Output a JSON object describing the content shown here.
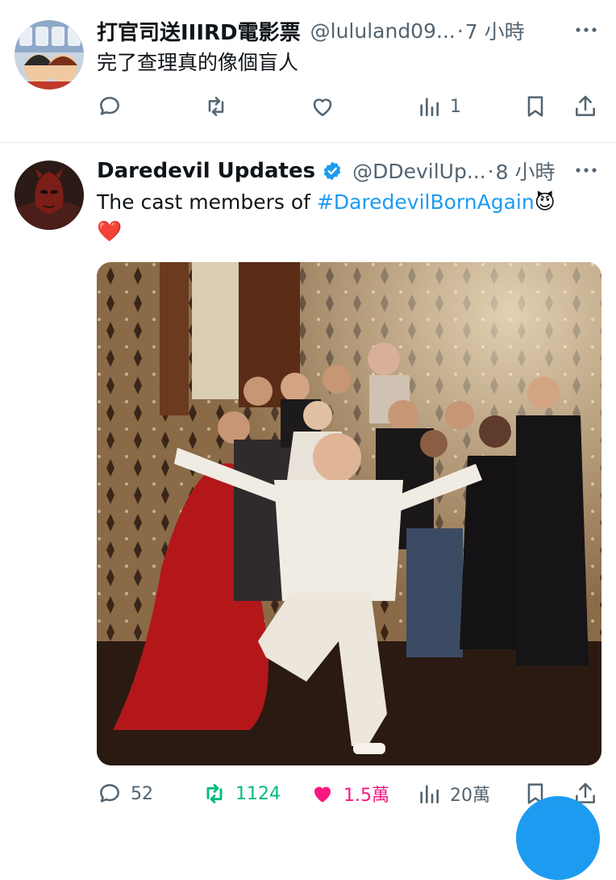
{
  "tweets": [
    {
      "name": "打官司送IIIRD電影票",
      "handle": "@lululand09...",
      "time": "7 小時",
      "text": "完了查理真的像個盲人",
      "actions": {
        "replies": "",
        "retweets": "",
        "likes": "",
        "views": "1"
      }
    },
    {
      "name": "Daredevil Updates",
      "handle": "@DDevilUp...",
      "time": "8 小時",
      "text_prefix": "The cast members of ",
      "hashtag": "#DaredevilBornAgain",
      "emoji_after_hashtag": "😈",
      "emoji_line2": "❤️",
      "actions": {
        "replies": "52",
        "retweets": "1124",
        "likes": "1.5萬",
        "views": "20萬"
      }
    }
  ],
  "dot": "·",
  "colors": {
    "blue": "#1d9bf0",
    "retweet": "#00ba7c",
    "like": "#f91880",
    "muted": "#536471"
  }
}
